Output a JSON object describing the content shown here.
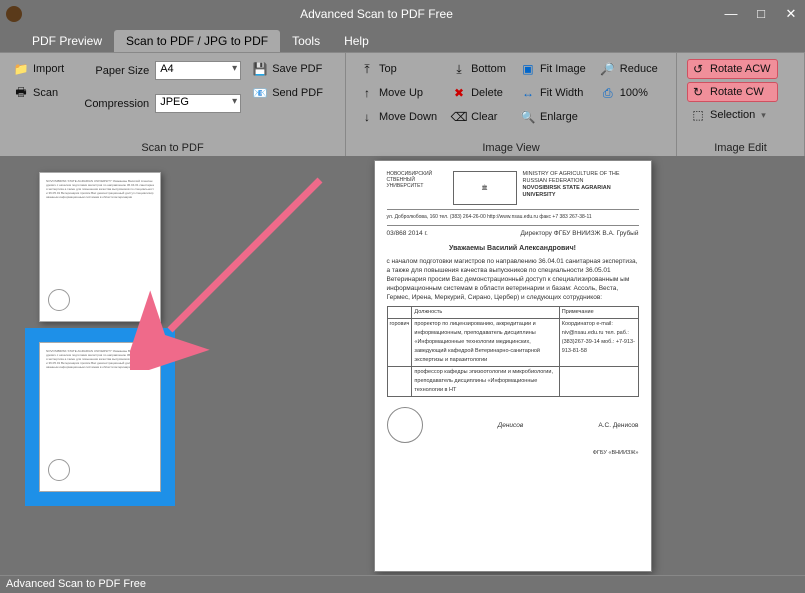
{
  "app": {
    "title": "Advanced Scan to PDF Free"
  },
  "window": {
    "min": "—",
    "max": "□",
    "close": "✕"
  },
  "tabs": [
    {
      "label": "PDF Preview"
    },
    {
      "label": "Scan to PDF / JPG to PDF"
    },
    {
      "label": "Tools"
    },
    {
      "label": "Help"
    }
  ],
  "ribbon": {
    "g1": {
      "import": "Import",
      "scan": "Scan",
      "paperSizeLabel": "Paper Size",
      "paperSize": "A4",
      "compressionLabel": "Compression",
      "compression": "JPEG",
      "savePdf": "Save PDF",
      "sendPdf": "Send PDF",
      "groupLabel": "Scan to PDF"
    },
    "g2": {
      "top": "Top",
      "moveUp": "Move Up",
      "moveDown": "Move Down",
      "bottom": "Bottom",
      "delete": "Delete",
      "clear": "Clear",
      "fitImage": "Fit Image",
      "fitWidth": "Fit Width",
      "enlarge": "Enlarge",
      "reduce": "Reduce",
      "hundred": "100%",
      "groupLabel": "Image View"
    },
    "g3": {
      "rotateAcw": "Rotate ACW",
      "rotateCw": "Rotate CW",
      "selection": "Selection",
      "groupLabel": "Image Edit"
    }
  },
  "doc": {
    "hdr_left": "НОВОСИБИРСКИЙ СТВЕННЫЙ УНИВЕРСИТЕТ",
    "hdr_right1": "MINISTRY OF AGRICULTURE OF THE RUSSIAN FEDERATION",
    "hdr_right2": "NOVOSIBIRSK STATE AGRARIAN UNIVERSITY",
    "addr": "ул. Добролюбова, 160  тел. (383) 264-26-00  http://www.nsau.edu.ru  факс +7 383 267-38-11",
    "num": "03/868   2014 г.",
    "to": "Директору ФГБУ ВНИИЗЖ В.А. Грубый",
    "greet": "Уважаемы Василий Александрович!",
    "body": "с началом подготовки магистров по направлению 36.04.01 санитарная экспертиза, а также для повышения качества выпускников по специальности 36.05.01 Ветеринария просим Вас демонстрационный доступ к специализированным ым информационным системам в области ветеринарии и базам: Ассоль, Веста, Гермес, Ирена, Меркурий, Сирано, Цербер) и следующих сотрудников:",
    "th1": "Должность",
    "th2": "Примечание",
    "r1a": "горович",
    "r1b": "проректор по лицензированию, аккредитации и информационным, преподаватель дисциплины «Информационные технологии медицинских, заведующий кафедрой Ветеринарно-санитарной экспертизы и паразитологии",
    "r1c": "Координатор e-mail: niv@nsau.edu.ru тел. раб.: (383)267-39-14 моб.: +7-913-913-81-58",
    "r2b": "профессор кафедры эпизоотологии и микробиологии, преподаватель дисциплины «Информационные технологии в НТ",
    "sig_name": "А.С. Денисов",
    "footer": "ФГБУ «ВНИИЗЖ»"
  },
  "status": "Advanced Scan to PDF Free"
}
